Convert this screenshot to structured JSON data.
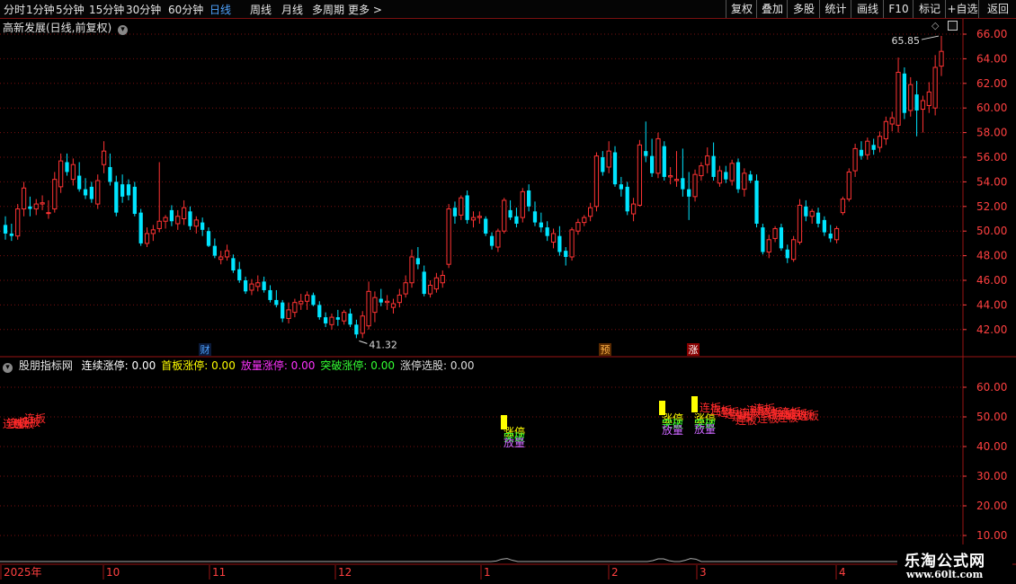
{
  "toolbar": {
    "periods": [
      "分时",
      "1分钟",
      "5分钟",
      "15分钟",
      "30分钟",
      "60分钟",
      "日线",
      "周线",
      "月线",
      "多周期",
      "更多 >"
    ],
    "active_period": "日线",
    "right_buttons": [
      "复权",
      "叠加",
      "多股",
      "统计",
      "画线",
      "F10",
      "标记",
      "+自选",
      "返回"
    ]
  },
  "main_chart": {
    "title": "高新发展(日线,前复权)",
    "high_label": "65.85",
    "low_label": "41.32",
    "event_markers": [
      {
        "text": "财",
        "color": "#4fa3ff",
        "bg": "#0a1a3a"
      },
      {
        "text": "预",
        "color": "#ffb347",
        "bg": "#5a2a00"
      },
      {
        "text": "涨",
        "color": "#ffffff",
        "bg": "#8a0000"
      }
    ]
  },
  "indicator": {
    "name": "股朋指标网",
    "values": [
      {
        "label": "连续涨停: 0.00",
        "color": "#ffffff"
      },
      {
        "label": "首板涨停: 0.00",
        "color": "#ffff00"
      },
      {
        "label": "放量涨停: 0.00",
        "color": "#ff33ff"
      },
      {
        "label": "突破涨停: 0.00",
        "color": "#33ff33"
      },
      {
        "label": "涨停选股: 0.00",
        "color": "#dddddd"
      }
    ],
    "signal_words": {
      "lianban": "连板",
      "shouban": "首板",
      "zhangting": "涨停",
      "fangliang": "放量",
      "tupo": "突破"
    }
  },
  "axes": {
    "price_ticks": [
      "66.00",
      "64.00",
      "62.00",
      "60.00",
      "58.00",
      "56.00",
      "54.00",
      "52.00",
      "50.00",
      "48.00",
      "46.00",
      "44.00",
      "42.00"
    ],
    "indicator_ticks": [
      "60.00",
      "50.00",
      "40.00",
      "30.00",
      "20.00",
      "10.00"
    ],
    "date_labels": [
      "2025年",
      "10",
      "11",
      "12",
      "1",
      "2",
      "3",
      "4"
    ]
  },
  "watermark": {
    "title": "乐淘公式网",
    "url": "www.60lt.com"
  },
  "colors": {
    "up": "#ff3333",
    "down": "#00e5ff",
    "grid": "#7a1010",
    "axis_text": "#ff4040"
  },
  "chart_data": {
    "type": "candlestick",
    "y_range": [
      41,
      67
    ],
    "ohlc": [
      [
        50.5,
        51.2,
        49.3,
        49.8
      ],
      [
        49.8,
        50.6,
        49.2,
        49.6
      ],
      [
        49.6,
        52.2,
        49.3,
        51.8
      ],
      [
        51.8,
        54.0,
        51.2,
        53.5
      ],
      [
        52.0,
        52.8,
        51.2,
        51.8
      ],
      [
        51.8,
        52.6,
        51.3,
        52.2
      ],
      [
        52.2,
        52.9,
        51.7,
        52.3
      ],
      [
        51.5,
        52.5,
        51.0,
        51.5
      ],
      [
        51.8,
        54.8,
        51.5,
        54.2
      ],
      [
        53.6,
        56.3,
        53.1,
        55.7
      ],
      [
        55.6,
        56.3,
        54.5,
        54.8
      ],
      [
        54.2,
        55.9,
        53.7,
        55.4
      ],
      [
        54.5,
        55.6,
        53.2,
        53.4
      ],
      [
        53.4,
        54.3,
        52.6,
        52.9
      ],
      [
        53.6,
        54.0,
        52.3,
        52.6
      ],
      [
        52.2,
        54.6,
        51.8,
        54.1
      ],
      [
        55.4,
        57.3,
        54.7,
        56.5
      ],
      [
        55.2,
        56.3,
        53.7,
        54.0
      ],
      [
        54.0,
        54.5,
        51.2,
        51.5
      ],
      [
        53.8,
        54.6,
        52.3,
        52.8
      ],
      [
        53.8,
        54.2,
        52.5,
        52.9
      ],
      [
        53.6,
        54.0,
        51.2,
        51.4
      ],
      [
        51.5,
        51.8,
        48.8,
        49.0
      ],
      [
        49.0,
        50.3,
        48.7,
        49.8
      ],
      [
        49.8,
        50.5,
        49.2,
        50.1
      ],
      [
        50.2,
        55.6,
        49.9,
        50.8
      ],
      [
        50.8,
        51.3,
        50.2,
        51.1
      ],
      [
        51.7,
        52.1,
        50.4,
        50.8
      ],
      [
        50.6,
        51.7,
        50.1,
        51.2
      ],
      [
        51.0,
        52.5,
        50.5,
        51.9
      ],
      [
        51.6,
        52.0,
        50.1,
        50.4
      ],
      [
        50.4,
        51.2,
        49.8,
        50.9
      ],
      [
        50.7,
        51.1,
        49.6,
        50.1
      ],
      [
        50.0,
        50.3,
        48.7,
        48.8
      ],
      [
        48.8,
        49.4,
        47.8,
        48.0
      ],
      [
        47.7,
        48.4,
        47.3,
        47.9
      ],
      [
        47.9,
        48.9,
        47.6,
        48.4
      ],
      [
        47.8,
        48.1,
        46.6,
        46.8
      ],
      [
        46.9,
        47.5,
        45.8,
        46.0
      ],
      [
        46.0,
        46.3,
        44.9,
        45.1
      ],
      [
        45.2,
        46.1,
        44.8,
        45.7
      ],
      [
        45.5,
        46.4,
        45.1,
        45.8
      ],
      [
        45.9,
        46.3,
        45.0,
        45.2
      ],
      [
        45.2,
        45.6,
        44.2,
        44.4
      ],
      [
        44.4,
        45.2,
        43.8,
        44.0
      ],
      [
        44.2,
        44.4,
        42.6,
        42.9
      ],
      [
        42.9,
        44.2,
        42.5,
        43.6
      ],
      [
        43.4,
        44.5,
        43.0,
        44.2
      ],
      [
        44.1,
        44.9,
        43.6,
        44.3
      ],
      [
        44.3,
        45.1,
        43.6,
        44.8
      ],
      [
        44.8,
        45.0,
        43.9,
        44.0
      ],
      [
        44.0,
        44.3,
        42.8,
        43.0
      ],
      [
        43.0,
        43.4,
        42.2,
        42.5
      ],
      [
        42.4,
        43.3,
        42.0,
        43.0
      ],
      [
        43.0,
        43.6,
        42.3,
        42.8
      ],
      [
        42.7,
        43.6,
        42.4,
        43.4
      ],
      [
        43.3,
        43.7,
        42.2,
        42.4
      ],
      [
        42.4,
        42.8,
        41.3,
        41.6
      ],
      [
        41.7,
        43.5,
        41.3,
        43.1
      ],
      [
        42.3,
        45.9,
        42.0,
        45.1
      ],
      [
        43.4,
        45.1,
        42.6,
        44.6
      ],
      [
        44.5,
        45.3,
        43.9,
        44.2
      ],
      [
        44.2,
        44.8,
        43.6,
        44.3
      ],
      [
        43.8,
        44.5,
        43.3,
        44.1
      ],
      [
        44.2,
        45.3,
        43.8,
        44.8
      ],
      [
        44.9,
        46.4,
        44.6,
        45.8
      ],
      [
        45.8,
        48.5,
        45.4,
        47.9
      ],
      [
        47.8,
        48.7,
        46.9,
        47.3
      ],
      [
        46.7,
        47.2,
        44.7,
        44.9
      ],
      [
        44.9,
        46.0,
        44.6,
        45.6
      ],
      [
        45.3,
        46.6,
        45.0,
        46.2
      ],
      [
        45.8,
        46.8,
        45.4,
        46.4
      ],
      [
        47.3,
        52.2,
        47.0,
        51.8
      ],
      [
        51.9,
        52.4,
        50.6,
        51.2
      ],
      [
        51.3,
        52.9,
        50.9,
        52.7
      ],
      [
        52.9,
        53.3,
        50.6,
        50.9
      ],
      [
        50.9,
        51.6,
        50.3,
        51.1
      ],
      [
        51.1,
        51.6,
        50.6,
        51.2
      ],
      [
        51.0,
        51.2,
        49.6,
        49.8
      ],
      [
        49.6,
        49.9,
        48.5,
        48.8
      ],
      [
        48.7,
        50.2,
        48.3,
        50.0
      ],
      [
        50.0,
        52.7,
        49.8,
        52.5
      ],
      [
        51.7,
        52.5,
        50.9,
        51.1
      ],
      [
        51.2,
        51.9,
        50.3,
        50.6
      ],
      [
        51.1,
        53.5,
        50.7,
        53.2
      ],
      [
        53.3,
        53.8,
        51.6,
        52.0
      ],
      [
        51.6,
        52.4,
        50.4,
        50.7
      ],
      [
        50.7,
        51.5,
        49.9,
        50.3
      ],
      [
        50.3,
        50.8,
        49.2,
        49.6
      ],
      [
        49.1,
        50.2,
        48.6,
        49.8
      ],
      [
        49.6,
        50.4,
        48.0,
        48.3
      ],
      [
        48.4,
        48.7,
        47.2,
        47.9
      ],
      [
        47.9,
        50.3,
        47.6,
        50.1
      ],
      [
        50.0,
        51.0,
        49.7,
        50.7
      ],
      [
        50.7,
        51.3,
        50.4,
        51.1
      ],
      [
        51.2,
        52.3,
        50.8,
        51.9
      ],
      [
        52.0,
        56.4,
        51.6,
        56.1
      ],
      [
        56.0,
        56.5,
        54.5,
        54.8
      ],
      [
        55.2,
        57.3,
        54.7,
        56.5
      ],
      [
        56.4,
        56.9,
        53.6,
        53.8
      ],
      [
        53.8,
        54.4,
        52.8,
        53.4
      ],
      [
        53.6,
        54.0,
        51.3,
        51.6
      ],
      [
        51.4,
        52.7,
        50.8,
        52.2
      ],
      [
        52.1,
        57.4,
        52.0,
        57.0
      ],
      [
        56.5,
        58.9,
        55.6,
        56.1
      ],
      [
        56.1,
        57.5,
        54.4,
        54.7
      ],
      [
        54.7,
        58.0,
        54.3,
        57.5
      ],
      [
        56.9,
        57.3,
        54.1,
        54.4
      ],
      [
        54.4,
        55.2,
        53.8,
        54.5
      ],
      [
        54.1,
        56.5,
        53.6,
        54.2
      ],
      [
        54.3,
        56.7,
        52.8,
        53.4
      ],
      [
        53.4,
        54.8,
        50.9,
        52.8
      ],
      [
        52.8,
        55.0,
        52.4,
        54.6
      ],
      [
        54.5,
        55.6,
        54.1,
        55.3
      ],
      [
        55.4,
        56.8,
        54.7,
        56.1
      ],
      [
        56.1,
        57.2,
        54.1,
        54.4
      ],
      [
        53.9,
        55.3,
        53.6,
        54.9
      ],
      [
        54.8,
        55.3,
        53.9,
        54.2
      ],
      [
        54.1,
        55.8,
        53.7,
        55.5
      ],
      [
        55.6,
        55.9,
        53.1,
        53.4
      ],
      [
        53.4,
        55.1,
        52.8,
        54.7
      ],
      [
        54.6,
        54.9,
        53.9,
        54.1
      ],
      [
        54.1,
        54.6,
        50.3,
        50.6
      ],
      [
        50.3,
        50.6,
        48.1,
        48.3
      ],
      [
        48.3,
        49.7,
        47.8,
        49.3
      ],
      [
        49.4,
        50.4,
        49.1,
        50.2
      ],
      [
        50.3,
        50.6,
        48.4,
        48.6
      ],
      [
        48.5,
        48.9,
        47.4,
        47.8
      ],
      [
        47.7,
        49.6,
        47.5,
        49.3
      ],
      [
        49.1,
        52.6,
        48.9,
        52.1
      ],
      [
        52.0,
        52.5,
        50.8,
        51.2
      ],
      [
        51.2,
        51.8,
        50.6,
        51.6
      ],
      [
        51.5,
        51.9,
        50.3,
        50.6
      ],
      [
        50.9,
        51.2,
        49.6,
        49.9
      ],
      [
        49.8,
        50.5,
        49.1,
        49.4
      ],
      [
        49.3,
        50.4,
        49.0,
        50.2
      ],
      [
        51.5,
        52.8,
        51.3,
        52.6
      ],
      [
        52.6,
        55.1,
        52.4,
        54.8
      ],
      [
        54.9,
        57.1,
        54.4,
        56.7
      ],
      [
        56.6,
        57.3,
        55.8,
        56.1
      ],
      [
        56.2,
        57.6,
        55.8,
        57.3
      ],
      [
        57.0,
        57.5,
        56.2,
        56.6
      ],
      [
        56.8,
        58.1,
        56.4,
        57.7
      ],
      [
        57.5,
        59.3,
        57.0,
        58.9
      ],
      [
        58.7,
        59.7,
        58.1,
        59.2
      ],
      [
        58.6,
        64.1,
        58.0,
        62.9
      ],
      [
        62.8,
        63.3,
        59.1,
        59.6
      ],
      [
        59.8,
        62.5,
        59.3,
        61.9
      ],
      [
        61.1,
        62.2,
        57.7,
        59.8
      ],
      [
        59.9,
        61.0,
        58.0,
        60.6
      ],
      [
        60.2,
        62.1,
        59.6,
        61.3
      ],
      [
        60.0,
        64.3,
        59.4,
        63.3
      ],
      [
        63.4,
        65.85,
        62.6,
        64.6
      ]
    ]
  }
}
